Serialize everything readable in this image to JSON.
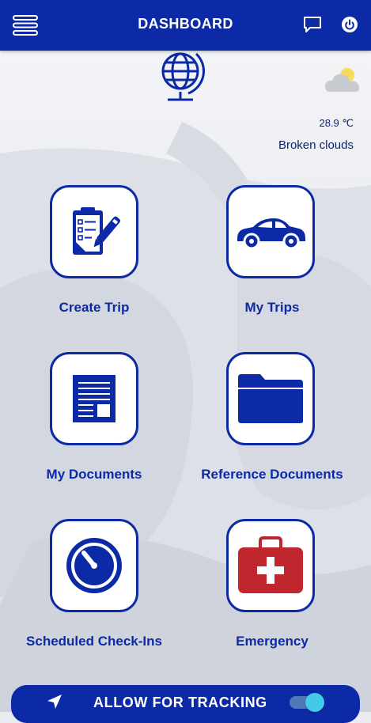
{
  "header": {
    "title": "DASHBOARD",
    "menu_icon": "hamburger-menu-icon",
    "chat_icon": "chat-bubble-icon",
    "power_icon": "power-icon"
  },
  "weather": {
    "temperature": "28.9 ℃",
    "description": "Broken clouds",
    "icon": "partly-cloudy-icon"
  },
  "tiles": [
    {
      "label": "Create Trip",
      "icon": "clipboard-pen-icon"
    },
    {
      "label": "My Trips",
      "icon": "car-icon"
    },
    {
      "label": "My Documents",
      "icon": "document-icon"
    },
    {
      "label": "Reference Documents",
      "icon": "folder-icon"
    },
    {
      "label": "Scheduled Check-Ins",
      "icon": "timer-icon"
    },
    {
      "label": "Emergency",
      "icon": "first-aid-kit-icon"
    }
  ],
  "tracking": {
    "label": "ALLOW FOR TRACKING",
    "enabled": true,
    "icon": "navigation-arrow-icon"
  },
  "colors": {
    "primary": "#0c2aa6",
    "toggle_knob": "#43c9e9",
    "emergency_red": "#c1262f",
    "text_dark": "#0c1f6e"
  }
}
